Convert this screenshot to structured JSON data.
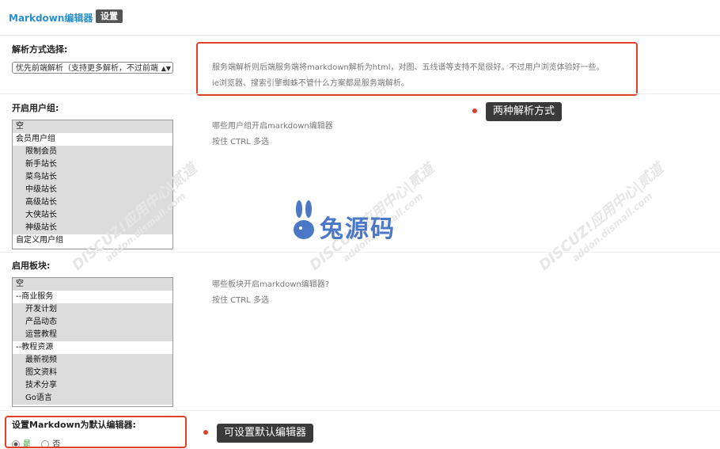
{
  "header": {
    "title": "Markdown编辑器",
    "settings_tab": "设置"
  },
  "parse_mode": {
    "label": "解析方式选择:",
    "selected": "优先前端解析（支持更多解析，不过前端",
    "help_line1": "服务端解析则后端服务端将markdown解析为html，对图、五线谱等支持不是很好。不过用户浏览体验好一些。",
    "help_line2": "ie浏览器、搜索引擎蜘蛛不管什么方案都是服务端解析。",
    "callout": "两种解析方式"
  },
  "user_groups": {
    "label": "开启用户组:",
    "options": [
      {
        "text": "空",
        "indent": false,
        "plain": false
      },
      {
        "text": "会员用户组",
        "indent": false,
        "plain": true
      },
      {
        "text": "限制会员",
        "indent": true,
        "plain": false
      },
      {
        "text": "新手站长",
        "indent": true,
        "plain": false
      },
      {
        "text": "菜鸟站长",
        "indent": true,
        "plain": false
      },
      {
        "text": "中级站长",
        "indent": true,
        "plain": false
      },
      {
        "text": "高级站长",
        "indent": true,
        "plain": false
      },
      {
        "text": "大侠站长",
        "indent": true,
        "plain": false
      },
      {
        "text": "神级站长",
        "indent": true,
        "plain": false
      },
      {
        "text": "自定义用户组",
        "indent": false,
        "plain": true
      }
    ],
    "help_line1": "哪些用户组开启markdown编辑器",
    "help_line2": "按住 CTRL 多选"
  },
  "forums": {
    "label": "启用板块:",
    "options": [
      {
        "text": "空",
        "indent": false,
        "plain": false
      },
      {
        "text": "--商业服务",
        "indent": false,
        "plain": true
      },
      {
        "text": "开发计划",
        "indent": true,
        "plain": false
      },
      {
        "text": "产品动态",
        "indent": true,
        "plain": false
      },
      {
        "text": "运营教程",
        "indent": true,
        "plain": false
      },
      {
        "text": "--教程资源",
        "indent": false,
        "plain": true
      },
      {
        "text": "最新视频",
        "indent": true,
        "plain": false
      },
      {
        "text": "图文资料",
        "indent": true,
        "plain": false
      },
      {
        "text": "技术分享",
        "indent": true,
        "plain": false
      },
      {
        "text": "Go语言",
        "indent": true,
        "plain": false
      }
    ],
    "help_line1": "哪些板块开启markdown编辑器?",
    "help_line2": "按住 CTRL 多选"
  },
  "default_editor": {
    "label": "设置Markdown为默认编辑器:",
    "yes": "是",
    "no": "否",
    "callout": "可设置默认编辑器"
  },
  "watermark": {
    "text": "DISCUZ!应用中心|贰道",
    "subtext": "addon.dismall.com",
    "logo": "兔源码"
  },
  "colors": {
    "accent": "#2a8fc9",
    "highlight": "#e0402a"
  }
}
